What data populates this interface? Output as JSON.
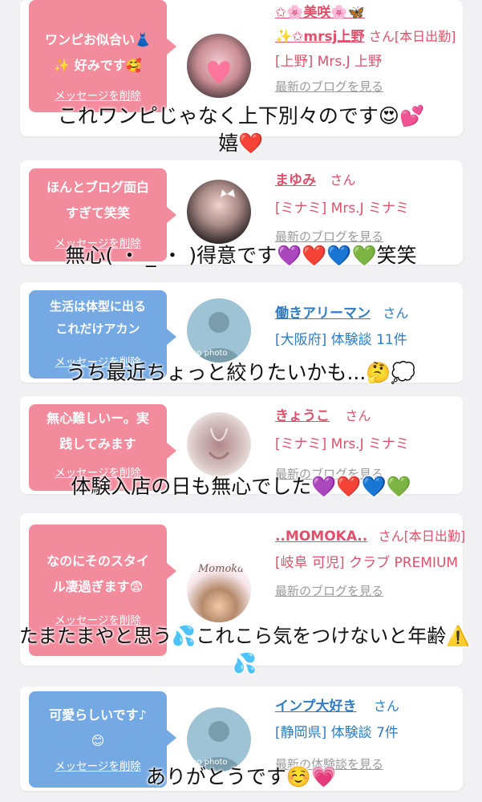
{
  "cards": [
    {
      "message": "ワンピお似合い👗\n✨ 好みです🥰",
      "delete_label": "メッセージを削除",
      "name": "✩🌸美咲🌸🦋\n✨✩mrsj上野",
      "san": "さん[本日出勤]",
      "shop": "[上野] Mrs.J 上野",
      "blog_link": "最新のブログを見る"
    },
    {
      "message": "ほんとブログ面白\nすぎて笑笑",
      "delete_label": "メッセージを削除",
      "name": "まゆみ",
      "san": "さん",
      "shop": "[ミナミ] Mrs.J ミナミ",
      "blog_link": "最新のブログを見る"
    },
    {
      "message": "生活は体型に出る\nこれだけアカン",
      "delete_label": "メッセージを削除",
      "name": "働きアリーマン",
      "san": "さん",
      "shop": "[大阪府] 体験談 11件",
      "avatar_text": "no photo"
    },
    {
      "message": "無心難しいー。実\n践してみます",
      "delete_label": "メッセージを削除",
      "name": "きょうこ",
      "san": "さん",
      "shop": "[ミナミ] Mrs.J ミナミ",
      "blog_link": "最新のブログを見る"
    },
    {
      "message": "なのにそのスタイ\nル凄過ぎます😨",
      "delete_label": "メッセージを削除",
      "name": "..MOMOKA..",
      "san": "さん[本日出勤]",
      "shop": "[岐阜 可児] クラブ PREMIUM",
      "blog_link": "最新のブログを見る",
      "avatar_text": "Momoka"
    },
    {
      "message": "可愛らしいです♪\n😊",
      "delete_label": "メッセージを削除",
      "name": "インプ大好き",
      "san": "さん",
      "shop": "[静岡県] 体験談 7件",
      "blog_link": "最新の体験談を見る",
      "avatar_text": "no photo"
    }
  ],
  "captions": [
    "これワンピじゃなく上下別々のです😍💕\n嬉❤️",
    "無心( ・ _ ・ )得意です💜❤️💙💚笑笑",
    "うち最近ちょっと絞りたいかも...🤔💭",
    "体験入店の日も無心でした💜❤️💙💚",
    "たまたまやと思う💦これこら気をつけないと年齢⚠️💦",
    "ありがとうです☺️💗"
  ],
  "colors": {
    "pink_bubble": "#f28b9c",
    "blue_bubble": "#74a9e4",
    "pink_text": "#e0506a",
    "blue_text": "#2f7cc4"
  }
}
